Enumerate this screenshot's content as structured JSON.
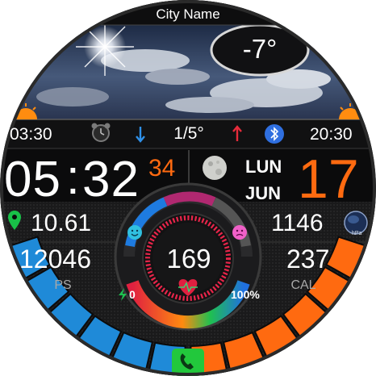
{
  "city": "City Name",
  "weather": {
    "temperature": "-7°",
    "condition_icon": "sun-through-clouds-icon"
  },
  "sun": {
    "sunrise": "03:30",
    "sunset": "20:30",
    "sunrise_icon": "sunrise-icon",
    "sunset_icon": "sunset-icon"
  },
  "status_row": {
    "wind": "1/5°",
    "alarm_icon": "alarm-clock-icon",
    "bluetooth_icon": "bluetooth-icon"
  },
  "time": {
    "hours": "05",
    "minutes": "32",
    "seconds": "34"
  },
  "date": {
    "day_of_week": "LUN",
    "month": "JUN",
    "day": "17",
    "moon_icon": "moon-phase-icon"
  },
  "stats": {
    "distance": "10.61",
    "steps": "12046",
    "steps_label": "PS",
    "pressure": "1146",
    "pressure_unit": "hPa",
    "calories": "237",
    "calories_label": "CAL"
  },
  "heart": {
    "rate": "169",
    "rate_fraction": 0.85
  },
  "battery": {
    "percent": "100%",
    "level": 1.0
  },
  "notifications": {
    "count": "0"
  },
  "colors": {
    "accent_orange": "#ff6a10",
    "blue": "#1f8ad8",
    "green": "#15b83a",
    "red": "#e8254a",
    "pink": "#f060c8",
    "cyan": "#30c0e0"
  }
}
